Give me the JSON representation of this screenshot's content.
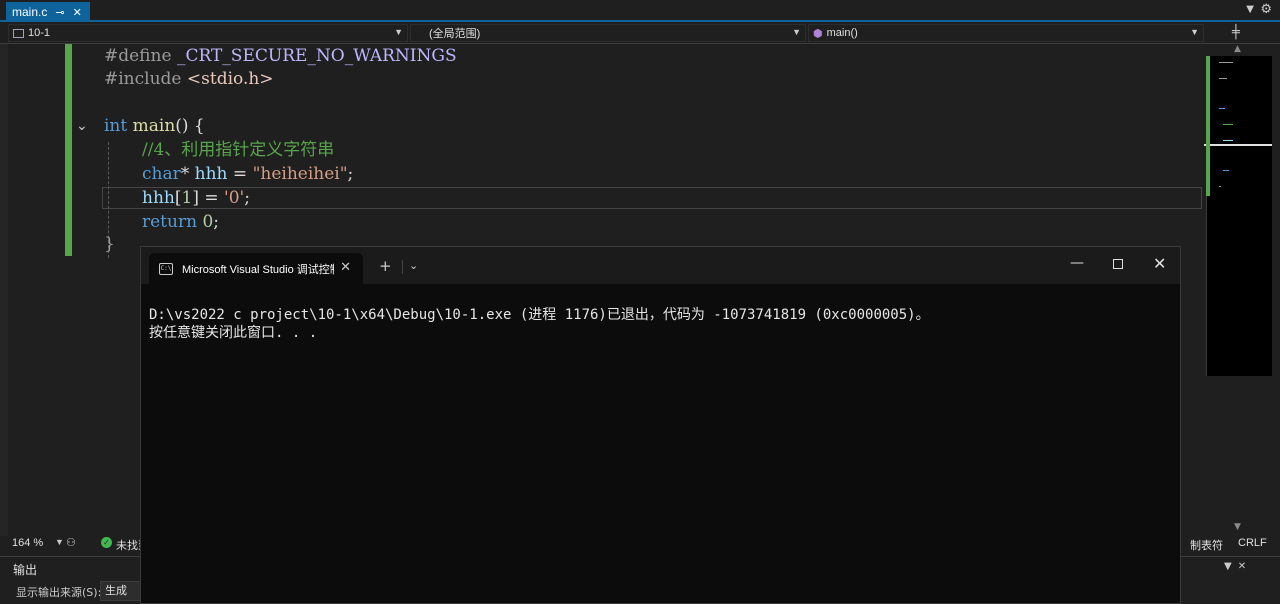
{
  "tab": {
    "filename": "main.c",
    "pin_icon": "pin-icon",
    "close_icon": "close-icon"
  },
  "navbar": {
    "project": "10-1",
    "scope": "(全局范围)",
    "member": "main()"
  },
  "editor": {
    "lines": {
      "l1": {
        "preproc": "#define ",
        "macro": "_CRT_SECURE_NO_WARNINGS"
      },
      "l2": {
        "preproc": "#include ",
        "file": "<stdio.h>"
      },
      "l4": {
        "kw": "int",
        "fn": " main",
        "rest": "() {"
      },
      "l5": {
        "comment": "//4、利用指针定义字符串"
      },
      "l6": {
        "kw": "char",
        "p1": "* ",
        "var": "hhh",
        "p2": " = ",
        "str": "\"heiheihei\"",
        "end": ";"
      },
      "l7": {
        "var": "hhh",
        "p1": "[",
        "num": "1",
        "p2": "] = ",
        "str": "'0'",
        "end": ";"
      },
      "l8": {
        "kw": "return",
        "p1": " ",
        "num": "0",
        "end": ";"
      },
      "l9": {
        "brace": "}"
      }
    }
  },
  "status": {
    "zoom": "164 %",
    "issues": "未找到",
    "tab_size": "制表符",
    "line_ending": "CRLF"
  },
  "output_panel": {
    "title": "输出",
    "source_label": "显示输出来源(S):",
    "source_value": "生成"
  },
  "console": {
    "tab_title": "Microsoft Visual Studio 调试控制台",
    "icon_text": "C:\\",
    "line1": "D:\\vs2022 c project\\10-1\\x64\\Debug\\10-1.exe (进程 1176)已退出，代码为 -1073741819 (0xc0000005)。",
    "line2": "按任意键关闭此窗口. . ."
  },
  "colors": {
    "accent": "#0e639c",
    "change_bar": "#57a64a",
    "keyword": "#569cd6",
    "comment": "#57a64a",
    "string": "#d69d85"
  }
}
